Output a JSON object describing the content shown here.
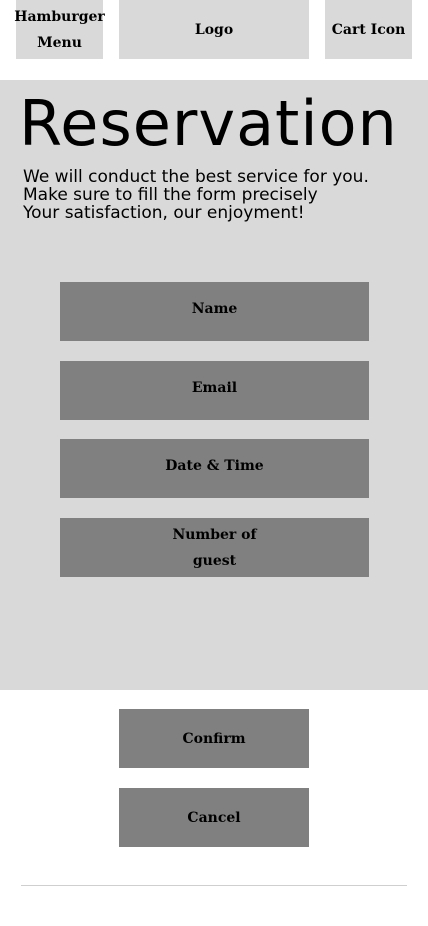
{
  "header": {
    "hamburger_label": "Hamburger Menu",
    "logo_label": "Logo",
    "cart_label": "Cart Icon"
  },
  "main": {
    "title": "Reservation",
    "description": [
      "We will conduct the best service for you.",
      "Make sure to fill the form precisely",
      "Your satisfaction, our enjoyment!"
    ]
  },
  "form": {
    "fields": [
      {
        "label": "Name"
      },
      {
        "label": "Email"
      },
      {
        "label": "Date & Time"
      },
      {
        "label": "Number of guest"
      }
    ]
  },
  "actions": {
    "confirm_label": "Confirm",
    "cancel_label": "Cancel"
  },
  "colors": {
    "panel_bg": "#d9d9d9",
    "field_bg": "#808080",
    "page_bg": "#ffffff"
  }
}
